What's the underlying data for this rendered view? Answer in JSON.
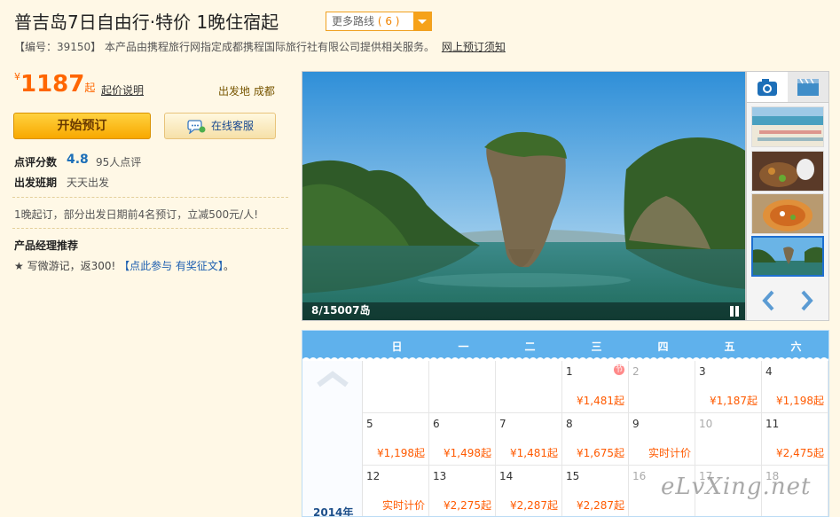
{
  "header": {
    "title": "普吉岛7日自由行·特价  1晚住宿起",
    "more_routes_label": "更多路线",
    "more_routes_count": "( 6 )",
    "info_text": "【编号：39150】 本产品由携程旅行网指定成都携程国际旅行社有限公司提供相关服务。",
    "notice_link": "网上预订须知"
  },
  "price": {
    "currency": "¥",
    "amount": "1187",
    "suffix": "起",
    "note_link": "起价说明",
    "departure": "出发地 成都"
  },
  "buttons": {
    "book": "开始预订",
    "service": "在线客服"
  },
  "rating": {
    "label": "点评分数",
    "score": "4.8",
    "count": "95人点评"
  },
  "schedule": {
    "label": "出发班期",
    "value": "天天出发"
  },
  "booking_note": "1晚起订，部分出发日期前4名预订，立减500元/人!",
  "pm": {
    "label": "产品经理推荐",
    "text": "★ 写微游记，返300! ",
    "link": "【点此参与 有奖征文】",
    "after": "。"
  },
  "gallery": {
    "caption": "8/15007岛",
    "icons": [
      "camera-icon",
      "video-icon"
    ]
  },
  "calendar": {
    "weekdays": [
      "日",
      "一",
      "二",
      "三",
      "四",
      "五",
      "六"
    ],
    "year_label": "2014年",
    "holiday_badge": "节",
    "weeks": [
      [
        {
          "day": "",
          "price": ""
        },
        {
          "day": "",
          "price": ""
        },
        {
          "day": "",
          "price": ""
        },
        {
          "day": "1",
          "price": "¥1,481起",
          "holiday": true
        },
        {
          "day": "2",
          "price": "",
          "dim": true
        },
        {
          "day": "3",
          "price": "¥1,187起"
        },
        {
          "day": "4",
          "price": "¥1,198起"
        }
      ],
      [
        {
          "day": "5",
          "price": "¥1,198起"
        },
        {
          "day": "6",
          "price": "¥1,498起"
        },
        {
          "day": "7",
          "price": "¥1,481起"
        },
        {
          "day": "8",
          "price": "¥1,675起"
        },
        {
          "day": "9",
          "price": "实时计价"
        },
        {
          "day": "10",
          "price": "",
          "dim": true
        },
        {
          "day": "11",
          "price": "¥2,475起"
        }
      ],
      [
        {
          "day": "12",
          "price": "实时计价"
        },
        {
          "day": "13",
          "price": "¥2,275起"
        },
        {
          "day": "14",
          "price": "¥2,287起"
        },
        {
          "day": "15",
          "price": "¥2,287起"
        },
        {
          "day": "16",
          "price": "",
          "dim": true
        },
        {
          "day": "17",
          "price": "",
          "dim": true
        },
        {
          "day": "18",
          "price": "",
          "dim": true
        }
      ]
    ]
  },
  "watermark": "eLvXing.net",
  "colors": {
    "accent_orange": "#ff6600",
    "calendar_blue": "#5fb1ec",
    "page_bg": "#fff8e6",
    "link_blue": "#1d5fb0"
  }
}
